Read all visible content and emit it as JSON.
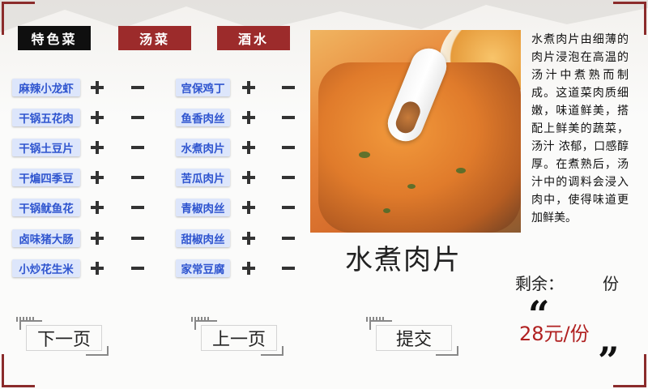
{
  "tabs": {
    "special": "特色菜",
    "soup": "汤菜",
    "drink": "酒水"
  },
  "menu": {
    "left": [
      "麻辣小龙虾",
      "干锅五花肉",
      "干锅土豆片",
      "干煸四季豆",
      "干锅鱿鱼花",
      "卤味猪大肠",
      "小炒花生米"
    ],
    "right": [
      "宫保鸡丁",
      "鱼香肉丝",
      "水煮肉片",
      "苦瓜肉片",
      "青椒肉丝",
      "甜椒肉丝",
      "家常豆腐"
    ]
  },
  "detail": {
    "description": "水煮肉片由细薄的肉片浸泡在高温的汤汁中煮熟而制成。这道菜肉质细嫩，味道鲜美，搭配上鲜美的蔬菜，汤汁 浓郁，口感醇厚。在煮熟后，汤汁中的调料会浸入肉中，使得味道更加鲜美。",
    "name": "水煮肉片",
    "remain_label": "剩余：",
    "remain_unit": "份",
    "price": "28元/份"
  },
  "buttons": {
    "next": "下一页",
    "prev": "上一页",
    "submit": "提交"
  },
  "icons": {
    "plus": "plus-icon",
    "minus": "minus-icon"
  },
  "colors": {
    "accent": "#9c2b2b",
    "dish_text": "#2f55cf",
    "dish_bg": "#dde6fb",
    "price": "#b02020"
  }
}
